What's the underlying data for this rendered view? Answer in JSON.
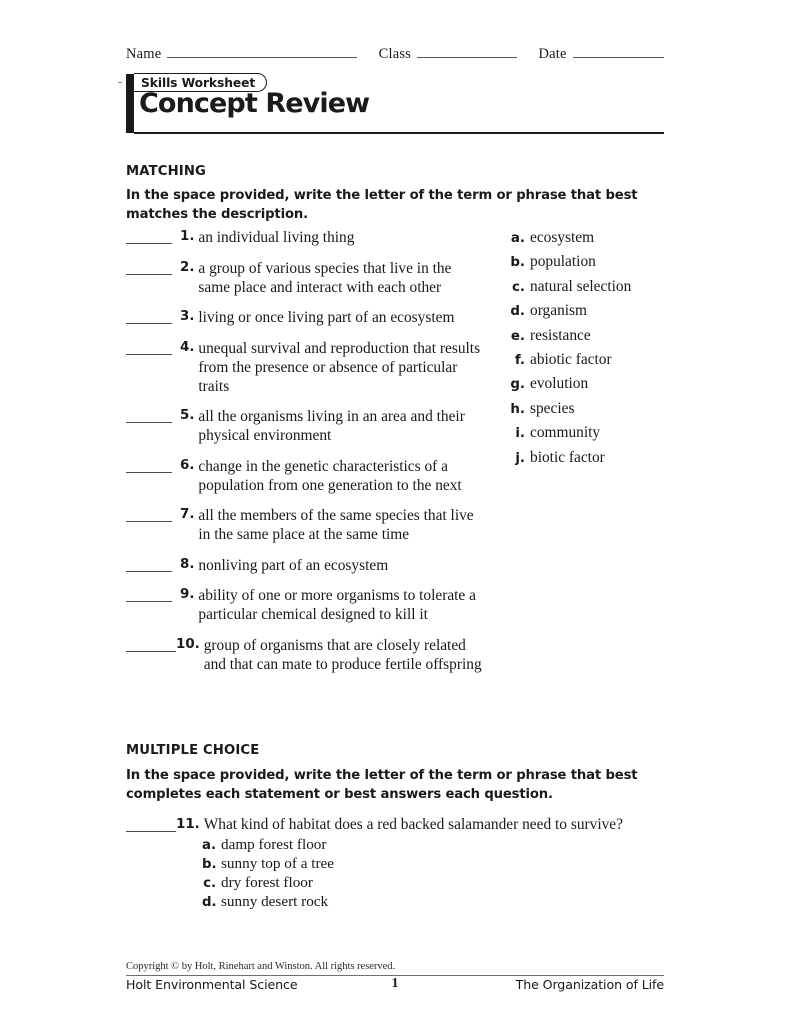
{
  "identity": {
    "name_label": "Name",
    "class_label": "Class",
    "date_label": "Date"
  },
  "masthead": {
    "badge": "Skills Worksheet",
    "title": "Concept Review"
  },
  "matching": {
    "heading": "MATCHING",
    "instructions": "In the space provided, write the letter of the term or phrase that best matches the description.",
    "items": [
      {
        "num": "1.",
        "text": "an individual living thing"
      },
      {
        "num": "2.",
        "text": "a group of various species that live in the same place and interact with each other"
      },
      {
        "num": "3.",
        "text": "living or once living part of an ecosystem"
      },
      {
        "num": "4.",
        "text": "unequal survival and reproduction that results from the presence or absence of particular traits"
      },
      {
        "num": "5.",
        "text": "all the organisms living in an area and their physical environment"
      },
      {
        "num": "6.",
        "text": "change in the genetic characteristics of a population from one generation to the next"
      },
      {
        "num": "7.",
        "text": "all the members of the same species that live in the same place at the same time"
      },
      {
        "num": "8.",
        "text": "nonliving part of an ecosystem"
      },
      {
        "num": "9.",
        "text": "ability of one or more organisms to tolerate a particular chemical designed to kill it"
      },
      {
        "num": "10.",
        "text": "group of organisms that are closely related and that can mate to produce fertile offspring"
      }
    ],
    "options": [
      {
        "letter": "a.",
        "term": "ecosystem"
      },
      {
        "letter": "b.",
        "term": "population"
      },
      {
        "letter": "c.",
        "term": "natural selection"
      },
      {
        "letter": "d.",
        "term": "organism"
      },
      {
        "letter": "e.",
        "term": "resistance"
      },
      {
        "letter": "f.",
        "term": "abiotic factor"
      },
      {
        "letter": "g.",
        "term": "evolution"
      },
      {
        "letter": "h.",
        "term": "species"
      },
      {
        "letter": "i.",
        "term": "community"
      },
      {
        "letter": "j.",
        "term": "biotic factor"
      }
    ]
  },
  "multiple_choice": {
    "heading": "MULTIPLE CHOICE",
    "instructions": "In the space provided, write the letter of the term or phrase that best completes each statement or best answers each question.",
    "question": {
      "num": "11.",
      "text": "What kind of habitat does a red backed salamander need to survive?",
      "choices": [
        {
          "letter": "a.",
          "text": "damp forest floor"
        },
        {
          "letter": "b.",
          "text": "sunny top of a tree"
        },
        {
          "letter": "c.",
          "text": "dry forest floor"
        },
        {
          "letter": "d.",
          "text": "sunny desert rock"
        }
      ]
    }
  },
  "footer": {
    "copyright": "Copyright © by Holt, Rinehart and Winston. All rights reserved.",
    "book": "Holt Environmental Science",
    "page": "1",
    "chapter": "The Organization of Life"
  }
}
